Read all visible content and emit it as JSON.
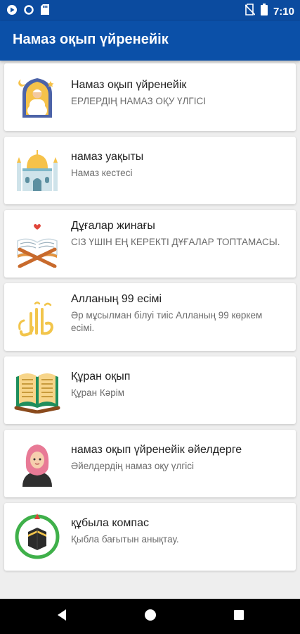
{
  "status_bar": {
    "time": "7:10",
    "icons": [
      "play-icon",
      "circle-icon",
      "sd-card-icon",
      "no-sim-icon",
      "battery-icon"
    ]
  },
  "app_bar": {
    "title": "Намаз оқып үйренейік"
  },
  "items": [
    {
      "icon": "praying-man-icon",
      "title": "Намаз оқып үйренейік",
      "subtitle": "ЕРЛЕРДІҢ НАМАЗ ОҚУ ҮЛГІСІ"
    },
    {
      "icon": "mosque-icon",
      "title": "намаз уақыты",
      "subtitle": "Намаз кестесі"
    },
    {
      "icon": "quran-stand-icon",
      "title": "Дұғалар жинағы",
      "subtitle": "СІЗ ҮШІН ЕҢ КЕРЕКТІ ДҰҒАЛАР ТОПТАМАСЫ."
    },
    {
      "icon": "allah-calligraphy-icon",
      "title": "Алланың 99 есімі",
      "subtitle": "Әр мұсылман білуі тиіс Алланың 99 көркем есімі."
    },
    {
      "icon": "quran-book-icon",
      "title": "Құран оқып",
      "subtitle": "Құран Кәрім"
    },
    {
      "icon": "hijab-woman-icon",
      "title": "намаз оқып үйренейік әйелдерге",
      "subtitle": "Әйелдердің намаз оқу үлгісі"
    },
    {
      "icon": "kaaba-compass-icon",
      "title": "құбыла компас",
      "subtitle": "Қыбла бағытын анықтау."
    }
  ],
  "nav_bar": {
    "buttons": [
      "back-icon",
      "home-icon",
      "recents-icon"
    ]
  }
}
